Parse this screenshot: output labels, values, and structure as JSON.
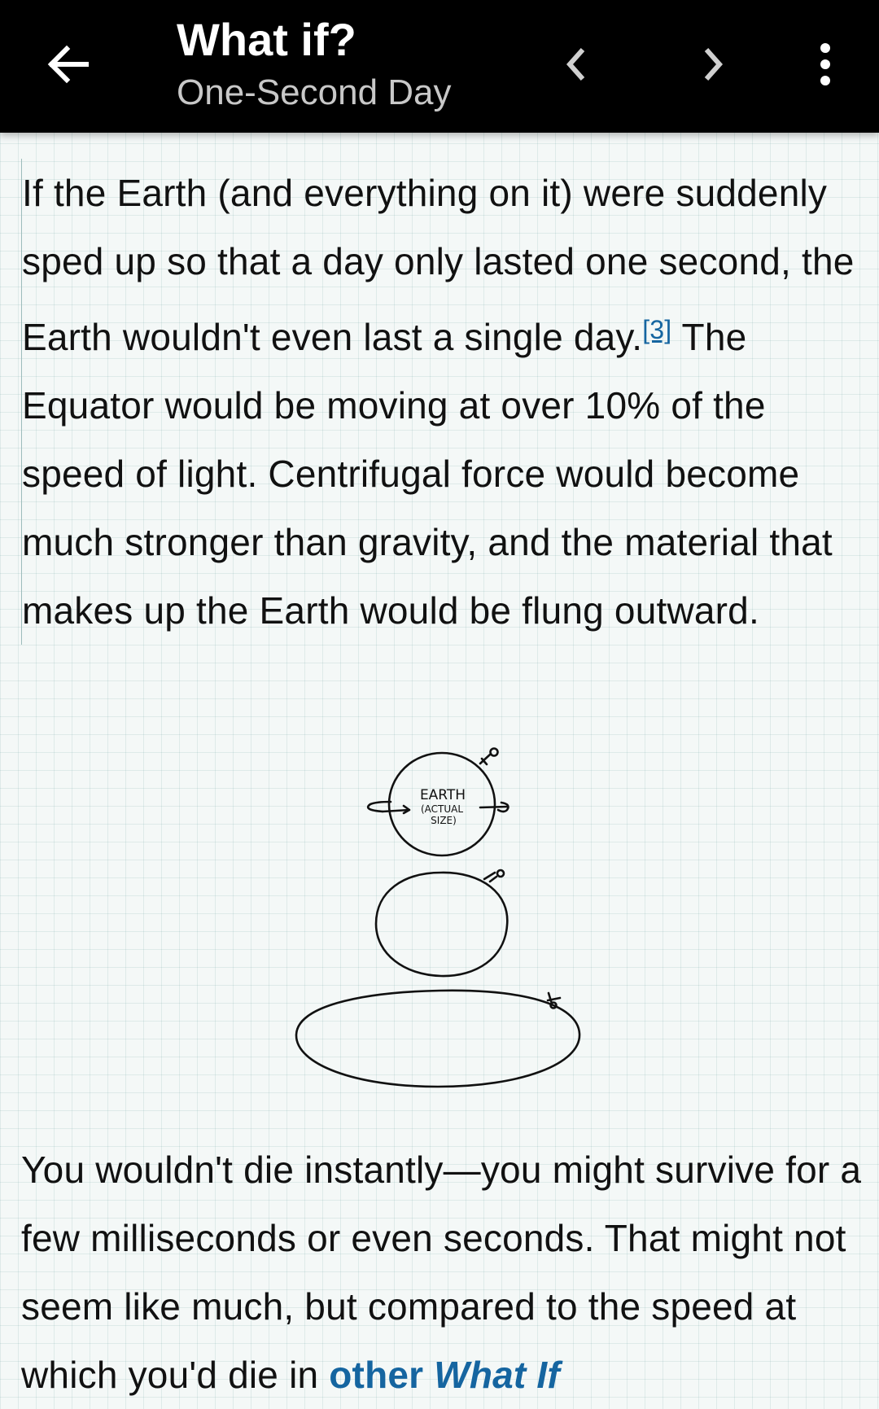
{
  "appbar": {
    "title": "What if?",
    "subtitle": "One-Second Day",
    "back_icon": "arrow-left-icon",
    "prev_icon": "chevron-left-icon",
    "next_icon": "chevron-right-icon",
    "more_icon": "more-vert-icon"
  },
  "article": {
    "p1_text_a": "If the Earth (and everything on it) were suddenly sped up so that a day only lasted one second, the Earth wouldn't even last a single day.",
    "p1_footnote": "[3]",
    "p1_text_b": " The Equator would be moving at over 10% of the speed of light. Centrifugal force would become much stronger than gravity, and the material that makes up the Earth would be flung outward.",
    "figure": {
      "label_line1": "EARTH",
      "label_line2": "(ACTUAL",
      "label_line3": "SIZE)"
    },
    "p2_text": "You wouldn't die instantly—you might survive for a few milliseconds or even seconds. That might not seem like much, but compared to the speed at which you'd die in ",
    "p2_link_a": "other ",
    "p2_link_b": "What If"
  }
}
